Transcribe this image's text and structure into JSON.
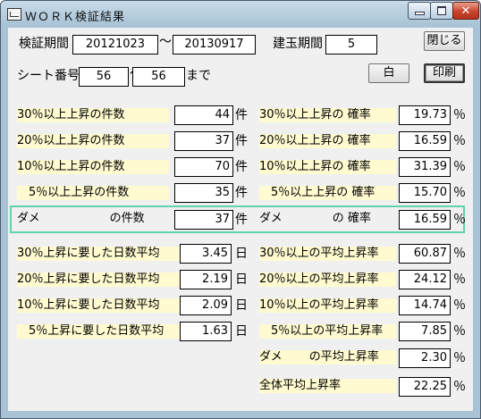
{
  "window": {
    "title": "ＷＯＲＫ検証結果"
  },
  "header": {
    "period_label": "検証期間",
    "period_start": "20121023",
    "period_tilde": "〜",
    "period_end": "20130917",
    "holding_label": "建玉期間",
    "holding_value": "5",
    "close_button": "閉じる",
    "sheet_label": "シート番号",
    "sheet_start": "56",
    "sheet_tilde": "〜",
    "sheet_end": "56",
    "sheet_suffix": "まで",
    "white_button": "白",
    "print_button": "印刷"
  },
  "counts": {
    "unit": "件",
    "rows": [
      {
        "label": "30％以上上昇の件数",
        "value": "44"
      },
      {
        "label": "20％以上上昇の件数",
        "value": "37"
      },
      {
        "label": "10％以上上昇の件数",
        "value": "70"
      },
      {
        "label": "　5％以上上昇の件数",
        "value": "35"
      },
      {
        "label": "ダメ　　　　　　の件数",
        "value": "37"
      }
    ]
  },
  "rates": {
    "unit": "％",
    "rows": [
      {
        "label": "30％以上上昇の 確率",
        "value": "19.73"
      },
      {
        "label": "20％以上上昇の 確率",
        "value": "16.59"
      },
      {
        "label": "10％以上上昇の 確率",
        "value": "31.39"
      },
      {
        "label": "　5％以上上昇の 確率",
        "value": "15.70"
      },
      {
        "label": "ダメ　　　　 の 確率",
        "value": "16.59"
      }
    ]
  },
  "days": {
    "unit": "日",
    "rows": [
      {
        "label": "30％上昇に要した日数平均",
        "value": "3.45"
      },
      {
        "label": "20％上昇に要した日数平均",
        "value": "2.19"
      },
      {
        "label": "10％上昇に要した日数平均",
        "value": "2.09"
      },
      {
        "label": "　5％上昇に要した日数平均",
        "value": "1.63"
      }
    ]
  },
  "avg_rise": {
    "unit": "％",
    "rows": [
      {
        "label": "30％以上の平均上昇率",
        "value": "60.87"
      },
      {
        "label": "20％以上の平均上昇率",
        "value": "24.12"
      },
      {
        "label": "10％以上の平均上昇率",
        "value": "14.74"
      },
      {
        "label": "　5％以上の平均上昇率",
        "value": "7.85"
      },
      {
        "label": "ダメ　　 の平均上昇率",
        "value": "2.30"
      },
      {
        "label": "全体平均上昇率",
        "value": "22.25"
      }
    ]
  },
  "colors": {
    "label_bg": "#fffad0",
    "dame_frame": "#5fd3ae"
  }
}
